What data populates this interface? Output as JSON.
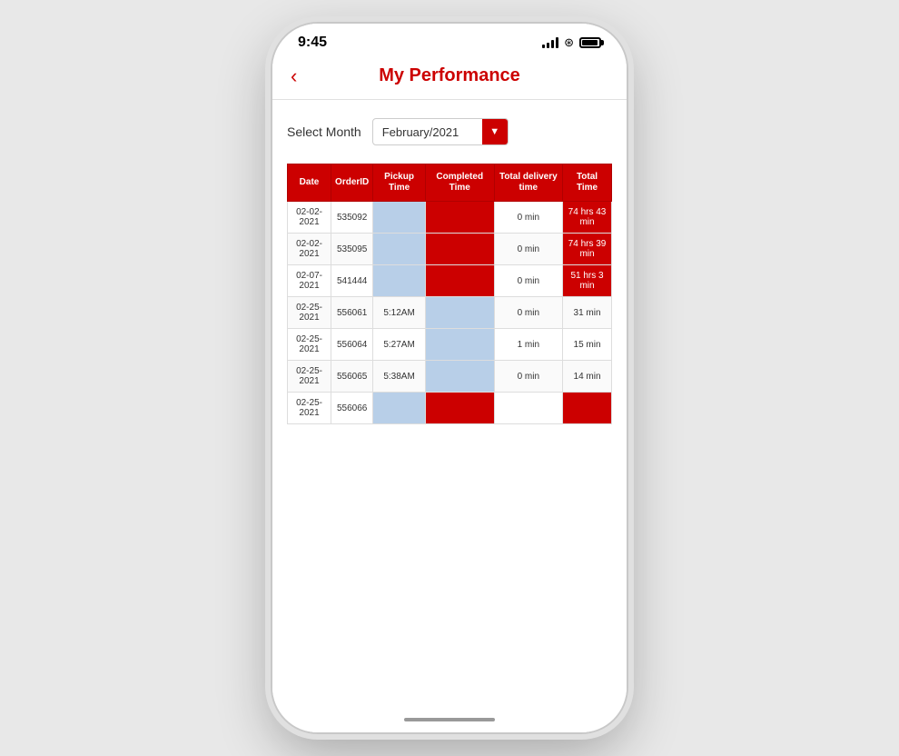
{
  "status": {
    "time": "9:45"
  },
  "header": {
    "title": "My Performance",
    "back_label": "‹"
  },
  "month_selector": {
    "label": "Select Month",
    "value": "February/2021",
    "arrow": "▼"
  },
  "table": {
    "headers": [
      "Date",
      "OrderID",
      "Pickup Time",
      "Completed Time",
      "Total delivery time",
      "Total Time"
    ],
    "rows": [
      {
        "date": "02-02-2021",
        "order_id": "535092",
        "pickup_time": "",
        "completed_time": "",
        "delivery_time": "0 min",
        "total_time": "74 hrs 43 min",
        "pickup_class": "cell-blue",
        "completed_class": "cell-red",
        "total_class": "cell-red"
      },
      {
        "date": "02-02-2021",
        "order_id": "535095",
        "pickup_time": "",
        "completed_time": "",
        "delivery_time": "0 min",
        "total_time": "74 hrs 39 min",
        "pickup_class": "cell-blue",
        "completed_class": "cell-red",
        "total_class": "cell-red"
      },
      {
        "date": "02-07-2021",
        "order_id": "541444",
        "pickup_time": "",
        "completed_time": "",
        "delivery_time": "0 min",
        "total_time": "51 hrs 3 min",
        "pickup_class": "cell-blue",
        "completed_class": "cell-red",
        "total_class": "cell-red"
      },
      {
        "date": "02-25-2021",
        "order_id": "556061",
        "pickup_time": "5:12AM",
        "completed_time": "",
        "delivery_time": "0 min",
        "total_time": "31 min",
        "pickup_class": "",
        "completed_class": "cell-blue",
        "total_class": ""
      },
      {
        "date": "02-25-2021",
        "order_id": "556064",
        "pickup_time": "5:27AM",
        "completed_time": "",
        "delivery_time": "1 min",
        "total_time": "15 min",
        "pickup_class": "",
        "completed_class": "cell-blue",
        "total_class": ""
      },
      {
        "date": "02-25-2021",
        "order_id": "556065",
        "pickup_time": "5:38AM",
        "completed_time": "",
        "delivery_time": "0 min",
        "total_time": "14 min",
        "pickup_class": "",
        "completed_class": "cell-blue",
        "total_class": ""
      },
      {
        "date": "02-25-2021",
        "order_id": "556066",
        "pickup_time": "",
        "completed_time": "",
        "delivery_time": "",
        "total_time": "",
        "pickup_class": "cell-blue",
        "completed_class": "cell-red",
        "total_class": "cell-red"
      }
    ]
  }
}
